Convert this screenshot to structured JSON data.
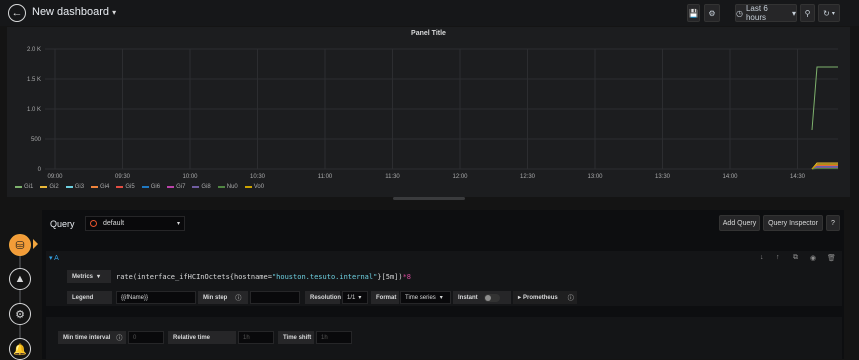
{
  "topbar": {
    "title": "New dashboard",
    "time_range": "Last 6 hours",
    "icons": [
      "back-icon",
      "save-icon",
      "gear-icon",
      "clock-icon",
      "search-icon",
      "refresh-icon"
    ]
  },
  "panel": {
    "title": "Panel Title"
  },
  "chart_data": {
    "type": "line",
    "title": "Panel Title",
    "x": [
      "09:00",
      "09:30",
      "10:00",
      "10:30",
      "11:00",
      "11:30",
      "12:00",
      "12:30",
      "13:00",
      "13:30",
      "14:00",
      "14:30"
    ],
    "ylim": [
      0,
      2000
    ],
    "y_ticks": [
      "0",
      "500",
      "1.0 K",
      "1.5 K",
      "2.0 K"
    ],
    "grid": true,
    "legend_placement": "bottom-left",
    "series": [
      {
        "name": "Gi1",
        "color": "#7eb26d"
      },
      {
        "name": "Gi2",
        "color": "#eab839"
      },
      {
        "name": "Gi3",
        "color": "#6ed0e0"
      },
      {
        "name": "Gi4",
        "color": "#ef843c"
      },
      {
        "name": "Gi5",
        "color": "#e24d42"
      },
      {
        "name": "Gi6",
        "color": "#1f78c1"
      },
      {
        "name": "Gi7",
        "color": "#ba43a9"
      },
      {
        "name": "Gi8",
        "color": "#705da0"
      },
      {
        "name": "Nu0",
        "color": "#508642"
      },
      {
        "name": "Vo0",
        "color": "#cca300"
      }
    ],
    "notes": "Series are flat until ~14:45, where Gi1 rises to ~1.7K and others stay near ~50-100."
  },
  "editor": {
    "query_label": "Query",
    "datasource": "default",
    "add_query": "Add Query",
    "query_inspector": "Query Inspector",
    "help": "?",
    "query_letter": "A",
    "metrics_label": "Metrics",
    "expr_prefix": "rate(interface_ifHCInOctets{hostname=",
    "expr_string": "\"houston.tesuto.internal\"",
    "expr_suffix": "}[5m])",
    "expr_op": "*8",
    "legend_label": "Legend",
    "legend_value": "{{ifName}}",
    "minstep_label": "Min step",
    "resolution_label": "Resolution",
    "resolution_value": "1/1",
    "format_label": "Format",
    "format_value": "Time series",
    "instant_label": "Instant",
    "prometheus_label": "Prometheus",
    "min_time_interval_label": "Min time interval",
    "min_time_interval_placeholder": "0",
    "relative_time_label": "Relative time",
    "relative_time_placeholder": "1h",
    "time_shift_label": "Time shift",
    "time_shift_placeholder": "1h"
  }
}
